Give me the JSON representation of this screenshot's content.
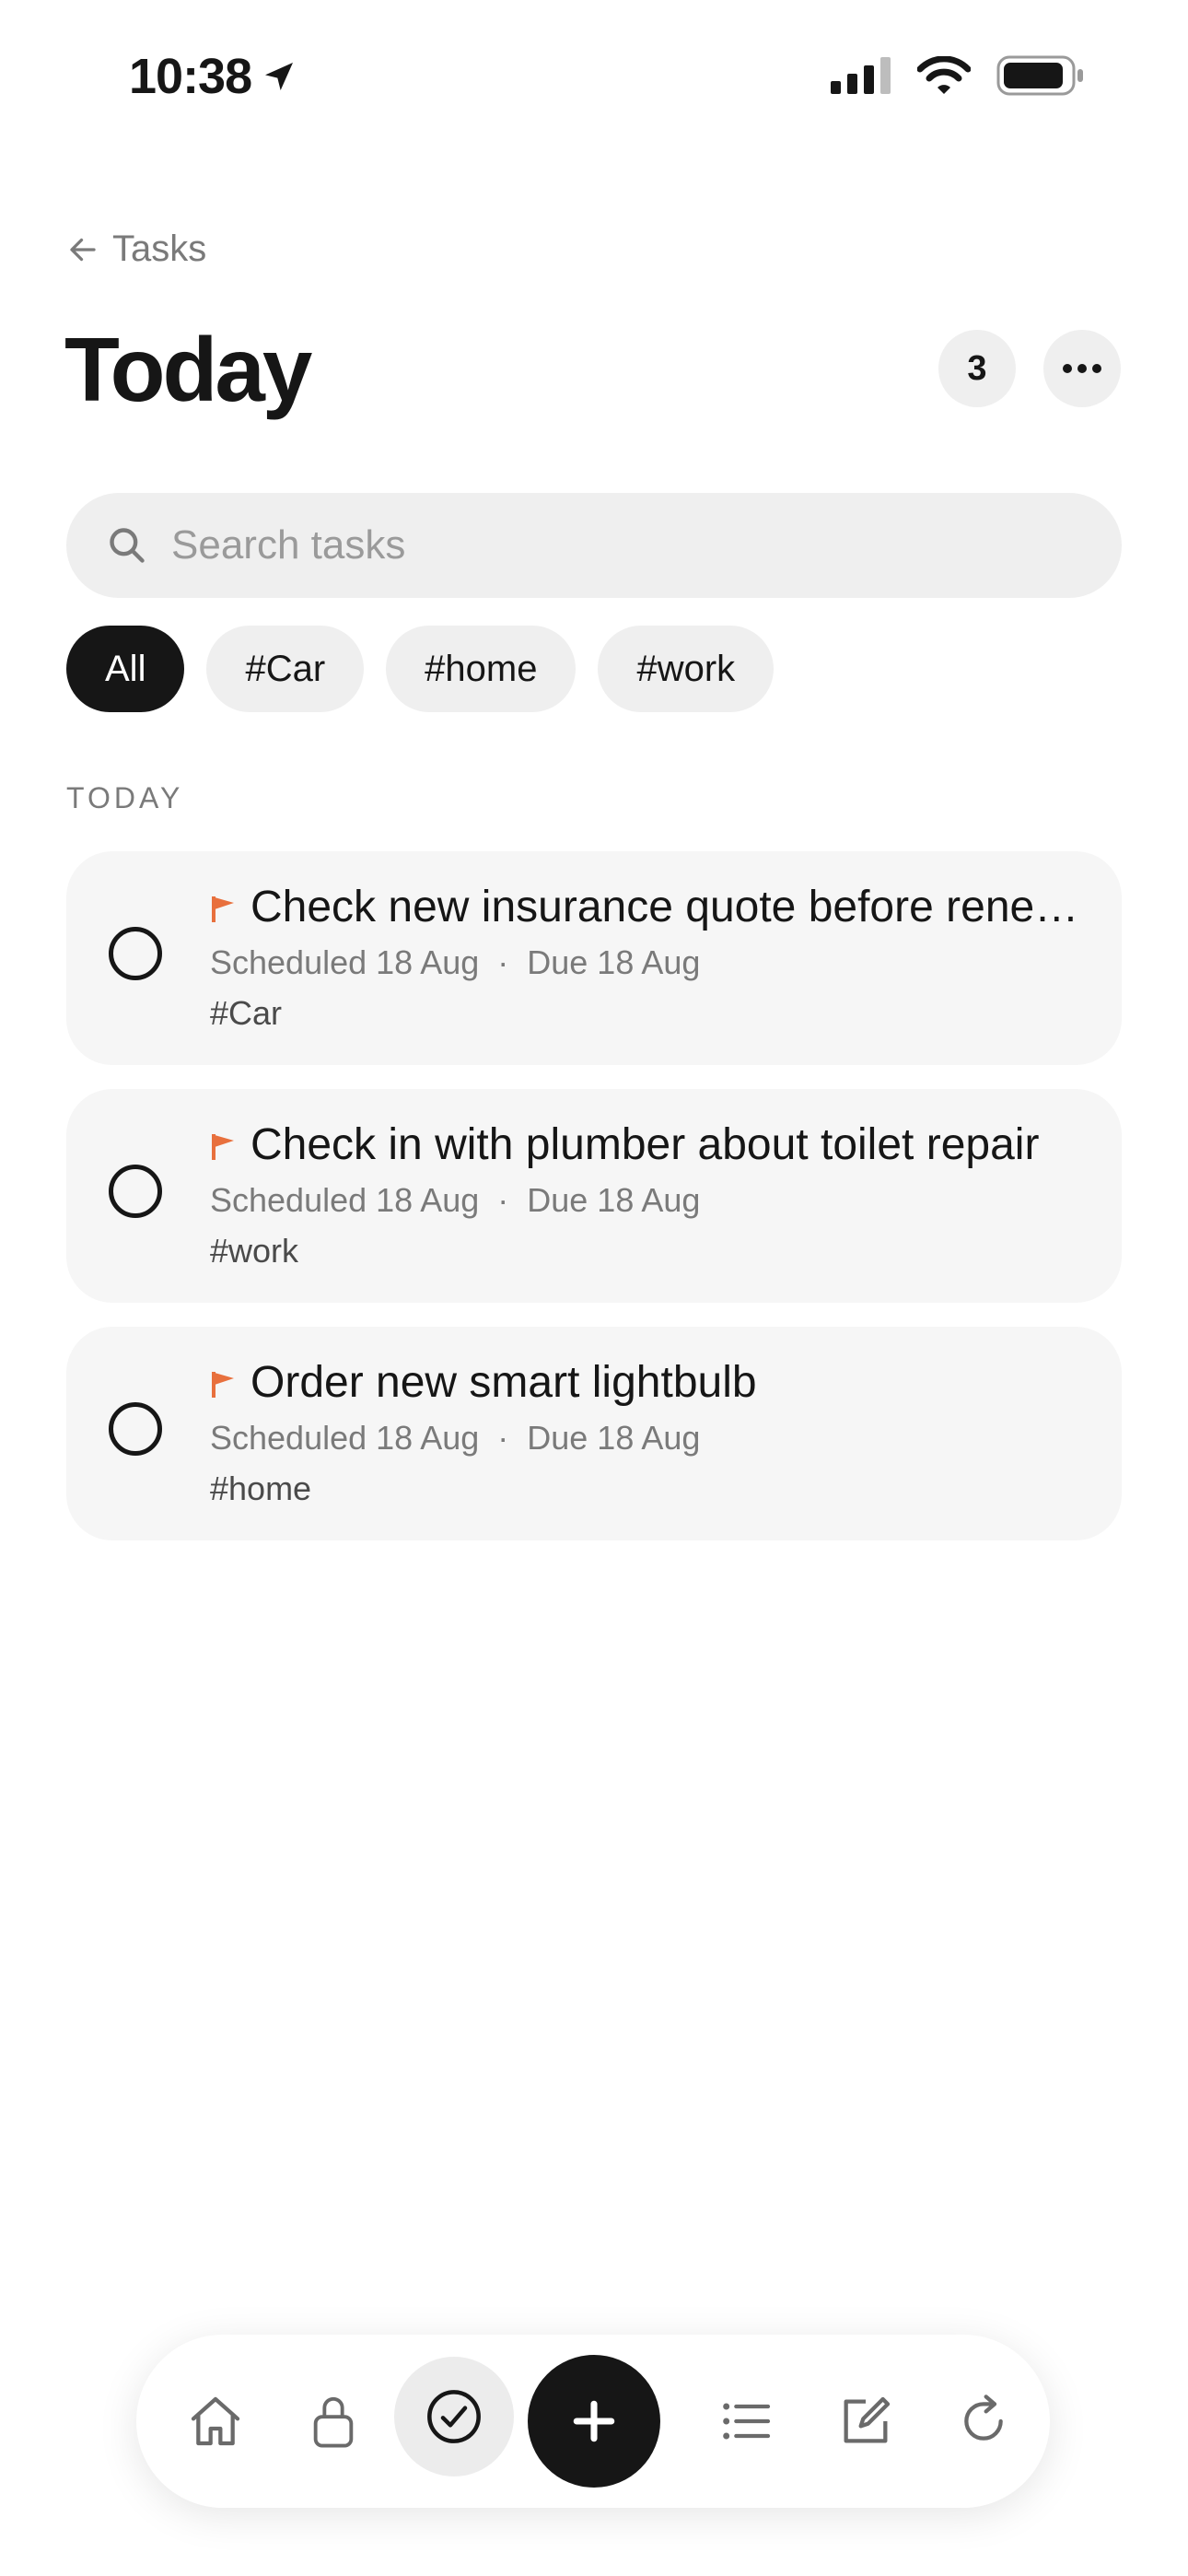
{
  "status_bar": {
    "time": "10:38"
  },
  "header": {
    "back_label": "Tasks",
    "title": "Today",
    "count": "3"
  },
  "search": {
    "placeholder": "Search tasks"
  },
  "filters": [
    "All",
    "#Car",
    "#home",
    "#work"
  ],
  "section_label": "TODAY",
  "tasks": [
    {
      "title": "Check new insurance quote before renewal",
      "scheduled": "Scheduled 18 Aug",
      "due": "Due 18 Aug",
      "tag": "#Car"
    },
    {
      "title": "Check in with plumber about toilet repair",
      "scheduled": "Scheduled 18 Aug",
      "due": "Due 18 Aug",
      "tag": "#work"
    },
    {
      "title": "Order new smart lightbulb",
      "scheduled": "Scheduled 18 Aug",
      "due": "Due 18 Aug",
      "tag": "#home"
    }
  ],
  "meta_separator": "·",
  "colors": {
    "accent_flag": "#e8703d",
    "primary": "#161616",
    "chip_bg": "#efefef",
    "card_bg": "#f6f6f6"
  },
  "bottom_nav": [
    "home-icon",
    "lock-icon",
    "check-circle-icon",
    "plus-icon",
    "list-icon",
    "compose-icon",
    "refresh-icon"
  ]
}
